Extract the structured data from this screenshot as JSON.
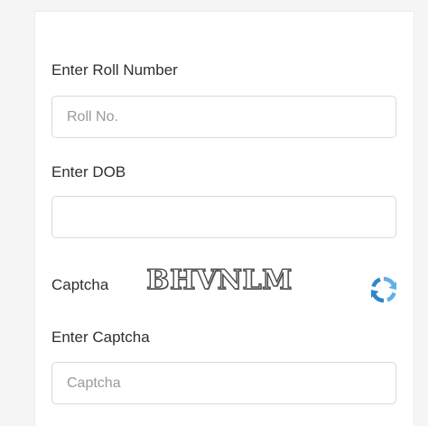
{
  "form": {
    "roll_label": "Enter Roll Number",
    "roll_placeholder": "Roll No.",
    "roll_value": "",
    "dob_label": "Enter DOB",
    "dob_value": "",
    "captcha_label": "Captcha",
    "captcha_text": "BHVNLM",
    "captcha_input_label": "Enter Captcha",
    "captcha_input_placeholder": "Captcha",
    "captcha_input_value": ""
  },
  "icons": {
    "refresh": "refresh-icon"
  },
  "colors": {
    "refresh_primary": "#2e86c9",
    "refresh_secondary": "#5fb0e8"
  }
}
